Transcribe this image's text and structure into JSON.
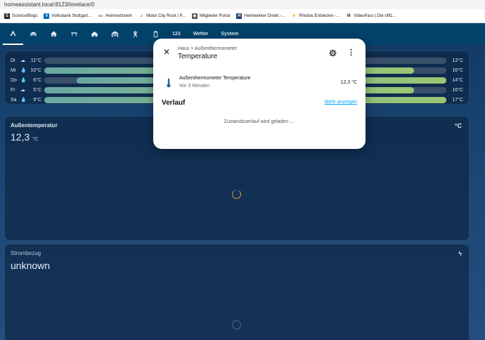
{
  "browser": {
    "url": "homeassistant.local:8123/lovelace/0",
    "bookmarks": [
      {
        "label": "ScienceBlogs",
        "icon": "scienceblogs-icon",
        "color": "#222222",
        "glyph": "S"
      },
      {
        "label": "Volksbank Stuttgart...",
        "icon": "volksbank-icon",
        "color": "#0066b3",
        "glyph": "V"
      },
      {
        "label": "Heimnetzwerk",
        "icon": "folder-icon",
        "color": "#ffffff",
        "glyph": "▭"
      },
      {
        "label": "Motor City Rock | P...",
        "icon": "music-note-icon",
        "color": "#ffffff",
        "glyph": "♫"
      },
      {
        "label": "Mitglieder Portal",
        "icon": "shield-icon",
        "color": "#555555",
        "glyph": "◆"
      },
      {
        "label": "Heimwerker Direkt -...",
        "icon": "heimwerker-icon",
        "color": "#1a3a6b",
        "glyph": "H"
      },
      {
        "label": "Rhodos Entdecker -...",
        "icon": "rhodos-icon",
        "color": "#ffffff",
        "glyph": "⚡"
      },
      {
        "label": "VideoPass | Die offiz...",
        "icon": "videopass-icon",
        "color": "#ffffff",
        "glyph": "M"
      }
    ]
  },
  "toolbar": {
    "tabs": [
      {
        "name": "tab-home-assistant",
        "icon": "home-assistant-icon",
        "label": ""
      },
      {
        "name": "tab-sofa",
        "icon": "sofa-icon",
        "label": ""
      },
      {
        "name": "tab-home",
        "icon": "home-icon",
        "label": ""
      },
      {
        "name": "tab-table",
        "icon": "table-icon",
        "label": ""
      },
      {
        "name": "tab-house",
        "icon": "house-icon",
        "label": ""
      },
      {
        "name": "tab-garage",
        "icon": "garage-icon",
        "label": ""
      },
      {
        "name": "tab-transmission-tower",
        "icon": "transmission-tower-icon",
        "label": ""
      },
      {
        "name": "tab-battery",
        "icon": "battery-icon",
        "label": ""
      },
      {
        "name": "tab-numbers",
        "icon": "",
        "label": "123"
      },
      {
        "name": "tab-wetter",
        "icon": "",
        "label": "Wetter"
      },
      {
        "name": "tab-system",
        "icon": "",
        "label": "System"
      }
    ]
  },
  "forecast": [
    {
      "day": "Di",
      "icon": "cloud-icon",
      "glyph": "☁",
      "low": "11°C",
      "high": "13°C",
      "bar_start": 0.0,
      "bar_end": 0.0
    },
    {
      "day": "Mi",
      "icon": "rain-icon",
      "glyph": "💧",
      "low": "10°C",
      "high": "16°C",
      "bar_start": 0.0,
      "bar_end": 0.92
    },
    {
      "day": "Do",
      "icon": "rain-icon",
      "glyph": "💧",
      "low": "6°C",
      "high": "14°C",
      "bar_start": 0.08,
      "bar_end": 1.0
    },
    {
      "day": "Fr",
      "icon": "cloud-icon",
      "glyph": "☁",
      "low": "5°C",
      "high": "16°C",
      "bar_start": 0.0,
      "bar_end": 0.92
    },
    {
      "day": "Sa",
      "icon": "rain-icon",
      "glyph": "💧",
      "low": "9°C",
      "high": "17°C",
      "bar_start": 0.0,
      "bar_end": 1.0
    }
  ],
  "temp_card": {
    "title": "Außentemperatur",
    "value": "12,3",
    "unit": "°C",
    "icon_text": "°C"
  },
  "power_card": {
    "title": "Strombezug",
    "value": "unknown",
    "icon": "lightning-icon",
    "glyph": "ϟ"
  },
  "dialog": {
    "breadcrumb": "Haus > Außenthermometer",
    "title": "Temperature",
    "entity_name": "Außenthermometer Temperature",
    "entity_time": "Vor 3 Minuten",
    "entity_state": "12,3 °C",
    "history_title": "Verlauf",
    "show_more": "Mehr anzeigen",
    "loading": "Zustandsverlauf wird geladen …"
  },
  "colors": {
    "toolbar": "#03426b",
    "accent_link": "#03a9f4",
    "spinner": "#e0a030"
  }
}
